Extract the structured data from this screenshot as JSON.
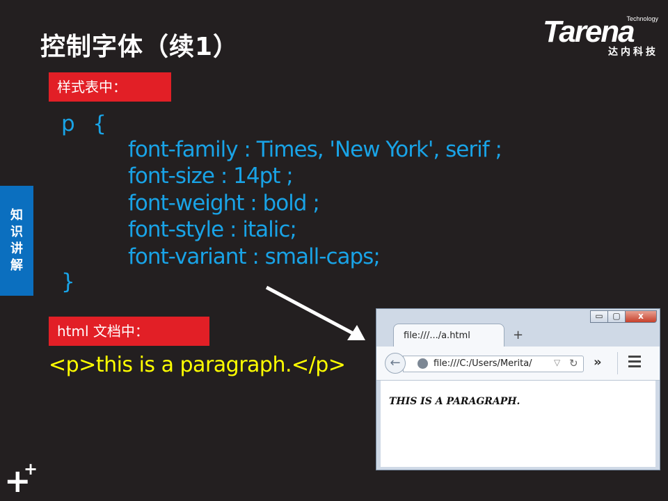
{
  "slide": {
    "title": "控制字体（续1）",
    "side_tab": [
      "知",
      "识",
      "讲",
      "解"
    ],
    "logo": {
      "tagline": "Technology",
      "brand": "Tarena",
      "sub": "达内科技"
    },
    "label_styles": "样式表中：",
    "label_html": "html 文档中：",
    "code": {
      "open": "p   {",
      "lines": [
        "font-family : Times, 'New York', serif ;",
        "font-size : 14pt ;",
        "font-weight : bold ;",
        "font-style : italic;",
        "font-variant : small-caps;"
      ],
      "close": "}"
    },
    "html_code": "<p>this is a paragraph.</p>"
  },
  "browser": {
    "tab_title": "file:///.../a.html",
    "new_tab": "+",
    "url": "file:///C:/Users/Merita/",
    "content_text": "THIS IS A PARAGRAPH.",
    "controls": {
      "minimize": "▭",
      "maximize": "▢",
      "close": "x"
    }
  },
  "colors": {
    "background": "#231f20",
    "label_red": "#e21f26",
    "code_blue": "#19a3e6",
    "html_yellow": "#ffff00",
    "side_tab_blue": "#0b6fbf"
  }
}
